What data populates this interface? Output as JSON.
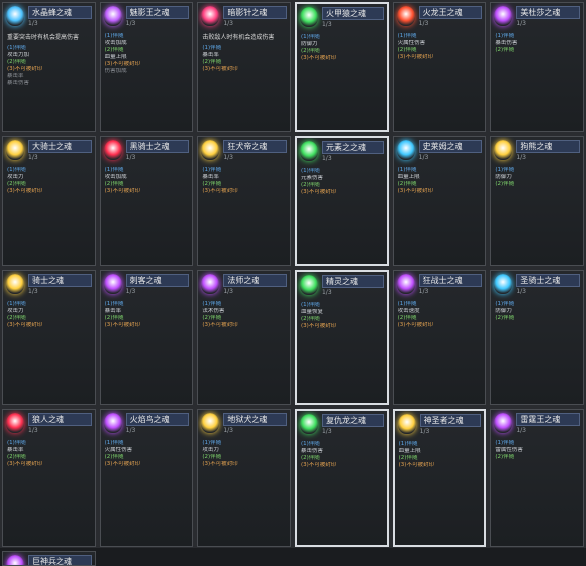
{
  "level": "1/3",
  "cards": [
    {
      "name": "水晶蜂之魂",
      "color": "#4fc3ff",
      "desc": "重要突击时有机会提高伤害",
      "lines": [
        [
          "c-blue",
          "(1)伴随"
        ],
        [
          "c-white",
          "攻击力加"
        ],
        [
          "c-green",
          "(2)伴随"
        ],
        [
          "c-orange",
          "(3)不可被封印"
        ],
        [
          "c-gray",
          "暴击率"
        ],
        [
          "c-gray",
          "暴击伤害"
        ]
      ]
    },
    {
      "name": "魅影王之魂",
      "color": "#c060ff",
      "desc": "",
      "lines": [
        [
          "c-blue",
          "(1)伴随"
        ],
        [
          "c-white",
          "攻击加成"
        ],
        [
          "c-green",
          "(2)伴随"
        ],
        [
          "c-white",
          "血量上限"
        ],
        [
          "c-orange",
          "(3)不可被封印"
        ],
        [
          "c-gray",
          "伤害加成"
        ]
      ]
    },
    {
      "name": "暗影针之魂",
      "color": "#ff4080",
      "desc": "击败敌人时有机会造成伤害",
      "lines": [
        [
          "c-blue",
          "(1)伴随"
        ],
        [
          "c-white",
          "暴击率"
        ],
        [
          "c-green",
          "(2)伴随"
        ],
        [
          "c-orange",
          "(3)不可被封印"
        ]
      ]
    },
    {
      "name": "火甲猿之魂",
      "color": "#40e060",
      "desc": "",
      "lines": [
        [
          "c-blue",
          "(1)伴随"
        ],
        [
          "c-white",
          "防御力"
        ],
        [
          "c-green",
          "(2)伴随"
        ],
        [
          "c-orange",
          "(3)不可被封印"
        ]
      ]
    },
    {
      "name": "火龙王之魂",
      "color": "#ff5030",
      "desc": "",
      "lines": [
        [
          "c-blue",
          "(1)伴随"
        ],
        [
          "c-white",
          "火属性伤害"
        ],
        [
          "c-green",
          "(2)伴随"
        ],
        [
          "c-orange",
          "(3)不可被封印"
        ]
      ]
    },
    {
      "name": "美杜莎之魂",
      "color": "#c050ff",
      "desc": "",
      "lines": [
        [
          "c-blue",
          "(1)伴随"
        ],
        [
          "c-white",
          "暴击伤害"
        ],
        [
          "c-green",
          "(2)伴随"
        ]
      ]
    },
    {
      "name": "大骑士之魂",
      "color": "#ffd040",
      "desc": "",
      "lines": [
        [
          "c-blue",
          "(1)伴随"
        ],
        [
          "c-white",
          "攻击力"
        ],
        [
          "c-green",
          "(2)伴随"
        ],
        [
          "c-orange",
          "(3)不可被封印"
        ]
      ]
    },
    {
      "name": "黑骑士之魂",
      "color": "#ff3050",
      "desc": "",
      "lines": [
        [
          "c-blue",
          "(1)伴随"
        ],
        [
          "c-white",
          "攻击加成"
        ],
        [
          "c-green",
          "(2)伴随"
        ],
        [
          "c-orange",
          "(3)不可被封印"
        ]
      ]
    },
    {
      "name": "狂犬帝之魂",
      "color": "#ffd040",
      "desc": "",
      "lines": [
        [
          "c-blue",
          "(1)伴随"
        ],
        [
          "c-white",
          "暴击率"
        ],
        [
          "c-green",
          "(2)伴随"
        ],
        [
          "c-orange",
          "(3)不可被封印"
        ]
      ]
    },
    {
      "name": "元素之之魂",
      "color": "#40e060",
      "desc": "",
      "lines": [
        [
          "c-blue",
          "(1)伴随"
        ],
        [
          "c-white",
          "元素伤害"
        ],
        [
          "c-green",
          "(2)伴随"
        ],
        [
          "c-orange",
          "(3)不可被封印"
        ]
      ]
    },
    {
      "name": "史莱姆之魂",
      "color": "#40c8ff",
      "desc": "",
      "lines": [
        [
          "c-blue",
          "(1)伴随"
        ],
        [
          "c-white",
          "血量上限"
        ],
        [
          "c-green",
          "(2)伴随"
        ],
        [
          "c-orange",
          "(3)不可被封印"
        ]
      ]
    },
    {
      "name": "狗熊之魂",
      "color": "#ffd040",
      "desc": "",
      "lines": [
        [
          "c-blue",
          "(1)伴随"
        ],
        [
          "c-white",
          "防御力"
        ],
        [
          "c-green",
          "(2)伴随"
        ]
      ]
    },
    {
      "name": "骑士之魂",
      "color": "#ffd040",
      "desc": "",
      "lines": [
        [
          "c-blue",
          "(1)伴随"
        ],
        [
          "c-white",
          "攻击力"
        ],
        [
          "c-green",
          "(2)伴随"
        ],
        [
          "c-orange",
          "(3)不可被封印"
        ]
      ]
    },
    {
      "name": "刺客之魂",
      "color": "#c050ff",
      "desc": "",
      "lines": [
        [
          "c-blue",
          "(1)伴随"
        ],
        [
          "c-white",
          "暴击率"
        ],
        [
          "c-green",
          "(2)伴随"
        ],
        [
          "c-orange",
          "(3)不可被封印"
        ]
      ]
    },
    {
      "name": "法师之魂",
      "color": "#c050ff",
      "desc": "",
      "lines": [
        [
          "c-blue",
          "(1)伴随"
        ],
        [
          "c-white",
          "法术伤害"
        ],
        [
          "c-green",
          "(2)伴随"
        ],
        [
          "c-orange",
          "(3)不可被封印"
        ]
      ]
    },
    {
      "name": "精灵之魂",
      "color": "#40e060",
      "desc": "",
      "lines": [
        [
          "c-blue",
          "(1)伴随"
        ],
        [
          "c-white",
          "血量恢复"
        ],
        [
          "c-green",
          "(2)伴随"
        ],
        [
          "c-orange",
          "(3)不可被封印"
        ]
      ]
    },
    {
      "name": "狂战士之魂",
      "color": "#c050ff",
      "desc": "",
      "lines": [
        [
          "c-blue",
          "(1)伴随"
        ],
        [
          "c-white",
          "攻击速度"
        ],
        [
          "c-green",
          "(2)伴随"
        ],
        [
          "c-orange",
          "(3)不可被封印"
        ]
      ]
    },
    {
      "name": "圣骑士之魂",
      "color": "#40c8ff",
      "desc": "",
      "lines": [
        [
          "c-blue",
          "(1)伴随"
        ],
        [
          "c-white",
          "防御力"
        ],
        [
          "c-green",
          "(2)伴随"
        ]
      ]
    },
    {
      "name": "狼人之魂",
      "color": "#ff3050",
      "desc": "",
      "lines": [
        [
          "c-blue",
          "(1)伴随"
        ],
        [
          "c-white",
          "暴击率"
        ],
        [
          "c-green",
          "(2)伴随"
        ],
        [
          "c-orange",
          "(3)不可被封印"
        ]
      ]
    },
    {
      "name": "火焰鸟之魂",
      "color": "#c050ff",
      "desc": "",
      "lines": [
        [
          "c-blue",
          "(1)伴随"
        ],
        [
          "c-white",
          "火属性伤害"
        ],
        [
          "c-green",
          "(2)伴随"
        ],
        [
          "c-orange",
          "(3)不可被封印"
        ]
      ]
    },
    {
      "name": "地狱犬之魂",
      "color": "#ffd040",
      "desc": "",
      "lines": [
        [
          "c-blue",
          "(1)伴随"
        ],
        [
          "c-white",
          "攻击力"
        ],
        [
          "c-green",
          "(2)伴随"
        ],
        [
          "c-orange",
          "(3)不可被封印"
        ]
      ]
    },
    {
      "name": "复仇龙之魂",
      "color": "#40e060",
      "desc": "",
      "lines": [
        [
          "c-blue",
          "(1)伴随"
        ],
        [
          "c-white",
          "暴击伤害"
        ],
        [
          "c-green",
          "(2)伴随"
        ],
        [
          "c-orange",
          "(3)不可被封印"
        ]
      ]
    },
    {
      "name": "神圣者之魂",
      "color": "#ffd040",
      "desc": "",
      "lines": [
        [
          "c-blue",
          "(1)伴随"
        ],
        [
          "c-white",
          "血量上限"
        ],
        [
          "c-green",
          "(2)伴随"
        ],
        [
          "c-orange",
          "(3)不可被封印"
        ]
      ]
    },
    {
      "name": "雷霆王之魂",
      "color": "#c050ff",
      "desc": "",
      "lines": [
        [
          "c-blue",
          "(1)伴随"
        ],
        [
          "c-white",
          "雷属性伤害"
        ],
        [
          "c-green",
          "(2)伴随"
        ]
      ]
    },
    {
      "name": "巨神兵之魂",
      "color": "#c050ff",
      "desc": "",
      "lines": []
    }
  ]
}
